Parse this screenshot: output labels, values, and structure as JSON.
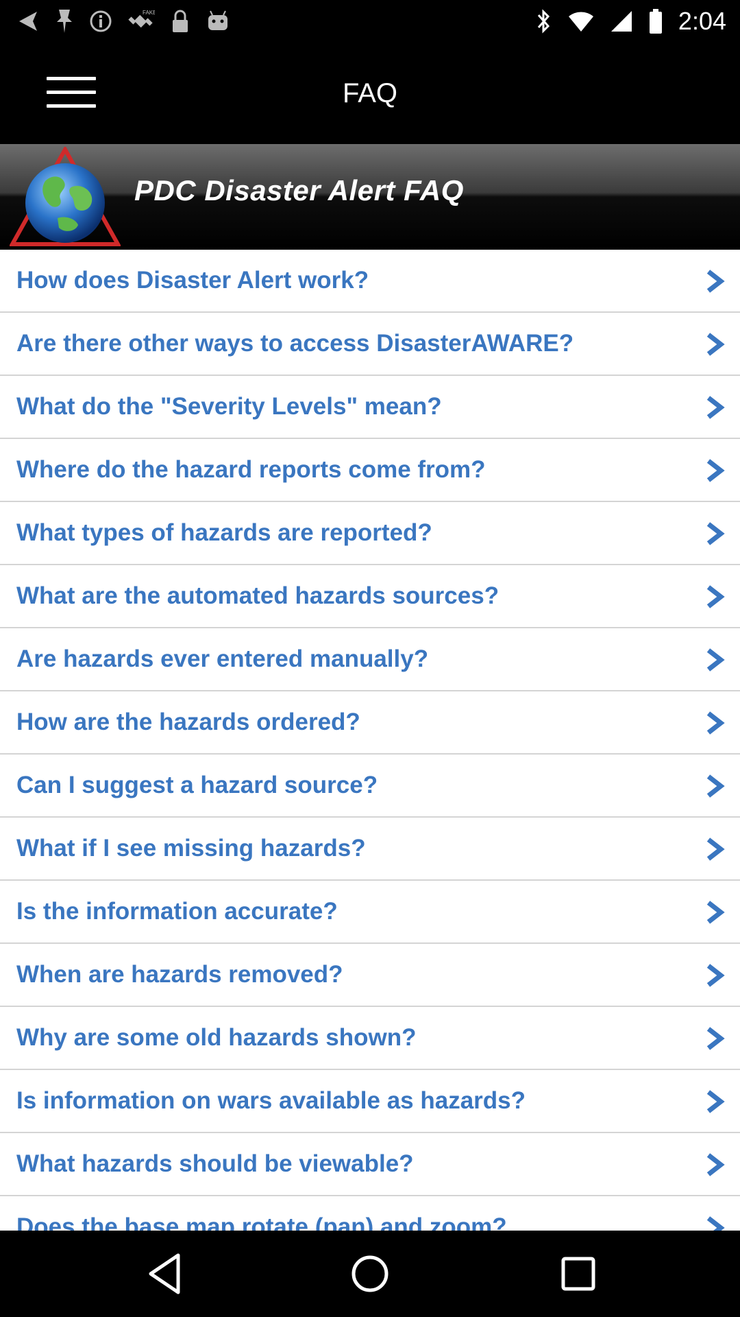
{
  "status_bar": {
    "time": "2:04",
    "icons_left": [
      "back-arrow-icon",
      "pin-icon",
      "info-icon",
      "fake-gps-icon",
      "lock-icon",
      "android-icon"
    ],
    "icons_right": [
      "bluetooth-icon",
      "wifi-icon",
      "signal-icon",
      "battery-icon"
    ]
  },
  "header": {
    "title": "FAQ",
    "menu_icon": "hamburger-menu-icon"
  },
  "banner": {
    "title": "PDC Disaster Alert FAQ",
    "logo_icon": "globe-triangle-logo-icon"
  },
  "faq": {
    "items": [
      {
        "question": "How does Disaster Alert work?"
      },
      {
        "question": "Are there other ways to access DisasterAWARE?"
      },
      {
        "question": "What do the \"Severity Levels\" mean?"
      },
      {
        "question": "Where do the hazard reports come from?"
      },
      {
        "question": "What types of hazards are reported?"
      },
      {
        "question": "What are the automated hazards sources?"
      },
      {
        "question": "Are hazards ever entered manually?"
      },
      {
        "question": "How are the hazards ordered?"
      },
      {
        "question": "Can I suggest a hazard source?"
      },
      {
        "question": "What if I see missing hazards?"
      },
      {
        "question": "Is the information accurate?"
      },
      {
        "question": "When are hazards removed?"
      },
      {
        "question": "Why are some old hazards shown?"
      },
      {
        "question": "Is information on wars available as hazards?"
      },
      {
        "question": "What hazards should be viewable?"
      },
      {
        "question": "Does the base map rotate (pan) and zoom?"
      }
    ],
    "chevron_icon": "chevron-right-icon"
  },
  "nav_bar": {
    "buttons": [
      "back-triangle-icon",
      "home-circle-icon",
      "recents-square-icon"
    ]
  },
  "colors": {
    "question_text": "#3a76c0",
    "divider": "#d4d4d4",
    "background": "#000000"
  }
}
